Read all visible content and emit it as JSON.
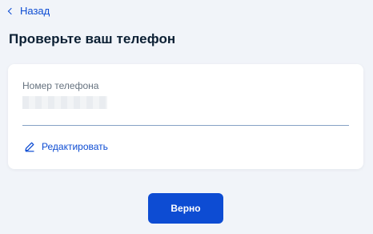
{
  "nav": {
    "back_label": "Назад"
  },
  "page": {
    "title": "Проверьте ваш телефон"
  },
  "phone_field": {
    "label": "Номер телефона",
    "value": ""
  },
  "edit": {
    "label": "Редактировать",
    "icon": "pencil-icon"
  },
  "actions": {
    "confirm_label": "Верно"
  },
  "colors": {
    "accent": "#0d4cd3",
    "background": "#f1f4f9",
    "card": "#ffffff",
    "text": "#0b1f33",
    "muted": "#66727f"
  }
}
